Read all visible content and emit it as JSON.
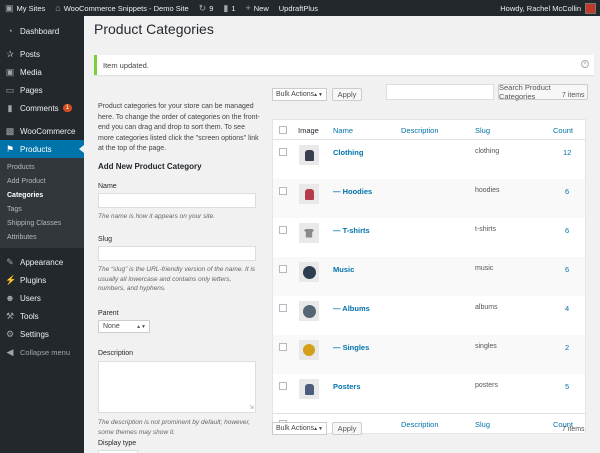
{
  "adminbar": {
    "my_sites": "My Sites",
    "site_name": "WooCommerce Snippets - Demo Site",
    "updates": "9",
    "comments": "1",
    "new": "New",
    "updraft": "UpdraftPlus",
    "howdy": "Howdy, Rachel McCollin"
  },
  "sidebar": {
    "items_top": [
      {
        "label": "Dashboard",
        "icon": "dashboard-icon"
      }
    ],
    "items_mid": [
      {
        "label": "Posts",
        "icon": "pin-icon"
      },
      {
        "label": "Media",
        "icon": "media-icon"
      },
      {
        "label": "Pages",
        "icon": "page-icon"
      },
      {
        "label": "Comments",
        "icon": "comment-icon",
        "badge": "1"
      }
    ],
    "woocommerce": "WooCommerce",
    "products": "Products",
    "submenu": [
      "Products",
      "Add Product",
      "Categories",
      "Tags",
      "Shipping Classes",
      "Attributes"
    ],
    "items_bottom": [
      {
        "label": "Appearance",
        "icon": "brush-icon"
      },
      {
        "label": "Plugins",
        "icon": "plug-icon"
      },
      {
        "label": "Users",
        "icon": "users-icon"
      },
      {
        "label": "Tools",
        "icon": "wrench-icon"
      },
      {
        "label": "Settings",
        "icon": "settings-icon"
      }
    ],
    "collapse": "Collapse menu"
  },
  "page": {
    "title": "Product Categories",
    "notice": "Item updated.",
    "search_button": "Search Product Categories"
  },
  "form": {
    "intro": "Product categories for your store can be managed here. To change the order of categories on the front-end you can drag and drop to sort them. To see more categories listed click the \"screen options\" link at the top of the page.",
    "heading": "Add New Product Category",
    "name_label": "Name",
    "name_hint": "The name is how it appears on your site.",
    "slug_label": "Slug",
    "slug_hint": "The “slug” is the URL-friendly version of the name. It is usually all lowercase and contains only letters, numbers, and hyphens.",
    "parent_label": "Parent",
    "parent_value": "None",
    "description_label": "Description",
    "description_hint": "The description is not prominent by default; however, some themes may show it.",
    "display_type_label": "Display type"
  },
  "table": {
    "bulk_actions": "Bulk Actions",
    "apply": "Apply",
    "item_count": "7 items",
    "columns": {
      "image": "Image",
      "name": "Name",
      "description": "Description",
      "slug": "Slug",
      "count": "Count"
    },
    "rows": [
      {
        "name": "Clothing",
        "slug": "clothing",
        "count": "12",
        "thumb": "hoodie",
        "color": "#3a3f4f"
      },
      {
        "name": "— Hoodies",
        "slug": "hoodies",
        "count": "6",
        "thumb": "hoodie",
        "color": "#b53a4c"
      },
      {
        "name": "— T-shirts",
        "slug": "t-shirts",
        "count": "6",
        "thumb": "tee",
        "color": "#8a8a8a"
      },
      {
        "name": "Music",
        "slug": "music",
        "count": "6",
        "thumb": "album",
        "color": "#2c3e50"
      },
      {
        "name": "— Albums",
        "slug": "albums",
        "count": "4",
        "thumb": "album",
        "color": "#566573"
      },
      {
        "name": "— Singles",
        "slug": "singles",
        "count": "2",
        "thumb": "disc",
        "color": "#d4a017"
      },
      {
        "name": "Posters",
        "slug": "posters",
        "count": "5",
        "thumb": "hoodie",
        "color": "#4b5d7a"
      }
    ]
  }
}
